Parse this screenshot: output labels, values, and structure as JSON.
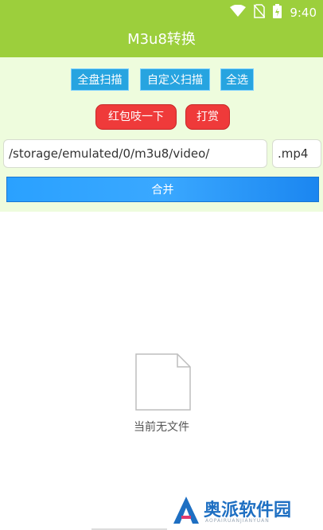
{
  "status_bar": {
    "time": "9:40",
    "icons": [
      "wifi-icon",
      "no-sim-icon",
      "battery-icon"
    ]
  },
  "app_bar": {
    "title": "M3u8转换"
  },
  "toolbar": {
    "full_scan_label": "全盘扫描",
    "custom_scan_label": "自定义扫描",
    "select_all_label": "全选"
  },
  "actions": {
    "red_packet_label": "红包吱一下",
    "tip_label": "打赏"
  },
  "form": {
    "path_value": "/storage/emulated/0/m3u8/video/",
    "extension_value": ".mp4"
  },
  "merge_label": "合并",
  "empty_state": {
    "icon": "file-icon",
    "text": "当前无文件"
  },
  "watermark": {
    "text": "奥派软件园",
    "sub_text": "AOPAIRUANJIANYUAN"
  },
  "colors": {
    "accent_green": "#9ccf3c",
    "panel_bg": "#eefcdd",
    "button_blue": "#27a4e0",
    "button_red": "#ef3a3a",
    "merge_blue": "#2aa1ff"
  }
}
